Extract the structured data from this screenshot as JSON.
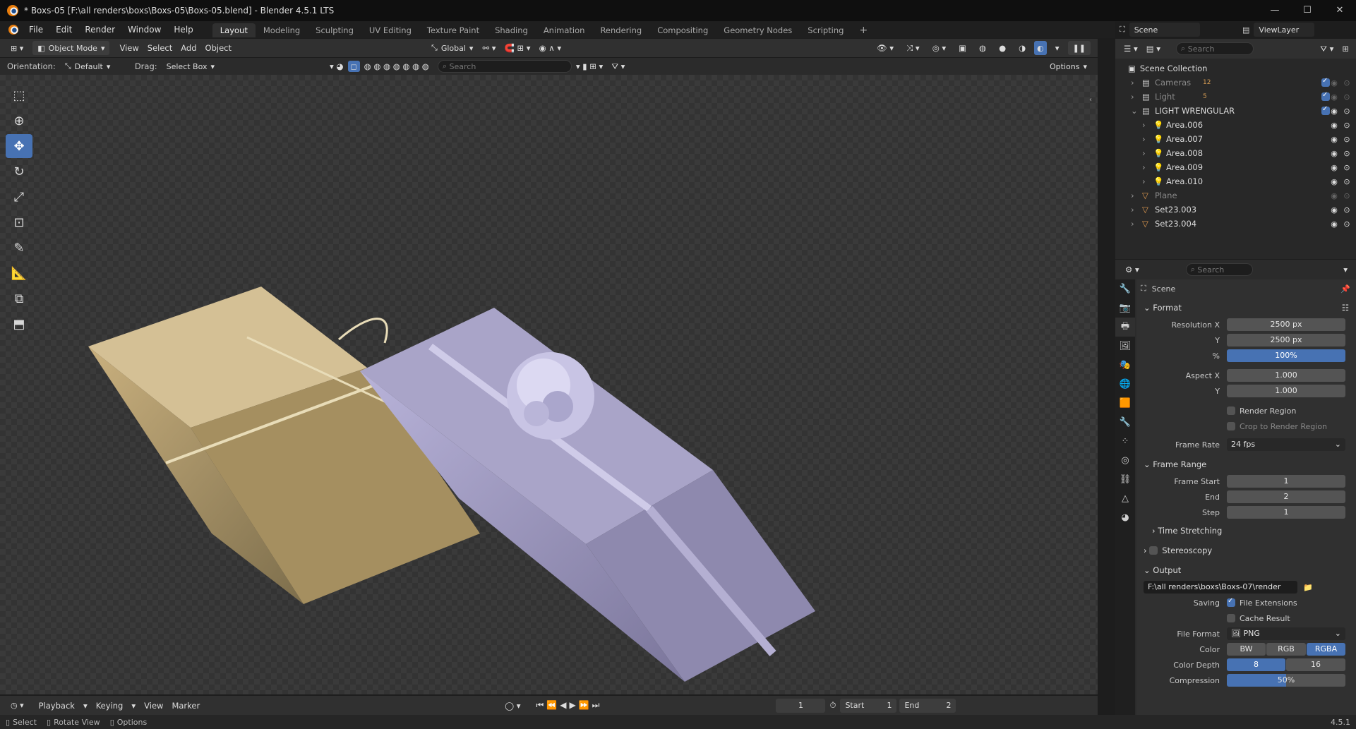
{
  "window": {
    "title": "* Boxs-05 [F:\\all renders\\boxs\\Boxs-05\\Boxs-05.blend] - Blender 4.5.1 LTS",
    "minimize": "—",
    "maximize": "☐",
    "close": "✕"
  },
  "menu": [
    "File",
    "Edit",
    "Render",
    "Window",
    "Help"
  ],
  "workspaces": [
    "Layout",
    "Modeling",
    "Sculpting",
    "UV Editing",
    "Texture Paint",
    "Shading",
    "Animation",
    "Rendering",
    "Compositing",
    "Geometry Nodes",
    "Scripting"
  ],
  "active_workspace": "Layout",
  "top_right": {
    "scene": "Scene",
    "viewlayer": "ViewLayer"
  },
  "header": {
    "mode": "Object Mode",
    "menus": [
      "View",
      "Select",
      "Add",
      "Object"
    ],
    "transform": "Global"
  },
  "tool_settings": {
    "orientation_label": "Orientation:",
    "orientation_value": "Default",
    "drag_label": "Drag:",
    "drag_value": "Select Box",
    "search_placeholder": "Search",
    "options": "Options"
  },
  "outliner": {
    "search_placeholder": "Search",
    "root": "Scene Collection",
    "items": [
      {
        "name": "Cameras",
        "badge": "12",
        "dim": true,
        "depth": 1
      },
      {
        "name": "Light",
        "badge": "5",
        "dim": true,
        "depth": 1
      },
      {
        "name": "LIGHT WRENGULAR",
        "badge": "",
        "dim": false,
        "depth": 1
      },
      {
        "name": "Area.006",
        "badge": "",
        "dim": false,
        "depth": 2
      },
      {
        "name": "Area.007",
        "badge": "",
        "dim": false,
        "depth": 2
      },
      {
        "name": "Area.008",
        "badge": "",
        "dim": false,
        "depth": 2
      },
      {
        "name": "Area.009",
        "badge": "",
        "dim": false,
        "depth": 2
      },
      {
        "name": "Area.010",
        "badge": "",
        "dim": false,
        "depth": 2
      },
      {
        "name": "Plane",
        "badge": "",
        "dim": true,
        "depth": 1
      },
      {
        "name": "Set23.003",
        "badge": "",
        "dim": false,
        "depth": 1
      },
      {
        "name": "Set23.004",
        "badge": "",
        "dim": false,
        "depth": 1
      }
    ]
  },
  "properties": {
    "search_placeholder": "Search",
    "context": "Scene",
    "format": {
      "title": "Format",
      "res_x_label": "Resolution X",
      "res_x": "2500 px",
      "res_y_label": "Y",
      "res_y": "2500 px",
      "pct_label": "%",
      "pct": "100%",
      "aspect_x_label": "Aspect X",
      "aspect_x": "1.000",
      "aspect_y_label": "Y",
      "aspect_y": "1.000",
      "render_region": "Render Region",
      "crop_region": "Crop to Render Region",
      "frame_rate_label": "Frame Rate",
      "frame_rate": "24 fps"
    },
    "frame_range": {
      "title": "Frame Range",
      "start_label": "Frame Start",
      "start": "1",
      "end_label": "End",
      "end": "2",
      "step_label": "Step",
      "step": "1",
      "time_stretching": "Time Stretching"
    },
    "stereoscopy": "Stereoscopy",
    "output": {
      "title": "Output",
      "path": "F:\\all renders\\boxs\\Boxs-07\\render",
      "saving_label": "Saving",
      "file_extensions": "File Extensions",
      "cache_result": "Cache Result",
      "file_format_label": "File Format",
      "file_format": "PNG",
      "color_label": "Color",
      "color_options": [
        "BW",
        "RGB",
        "RGBA"
      ],
      "color_selected": "RGBA",
      "depth_label": "Color Depth",
      "depth_options": [
        "8",
        "16"
      ],
      "depth_selected": "8",
      "compression_label": "Compression",
      "compression": "50%"
    }
  },
  "timeline": {
    "menus": [
      "Playback",
      "Keying",
      "View",
      "Marker"
    ],
    "current_frame": "1",
    "start_label": "Start",
    "start": "1",
    "end_label": "End",
    "end": "2"
  },
  "status": {
    "select": "Select",
    "rotate": "Rotate View",
    "options": "Options",
    "version": "4.5.1"
  },
  "colors": {
    "accent": "#4772b3",
    "orange": "#e87d0d",
    "bg": "#303030"
  }
}
